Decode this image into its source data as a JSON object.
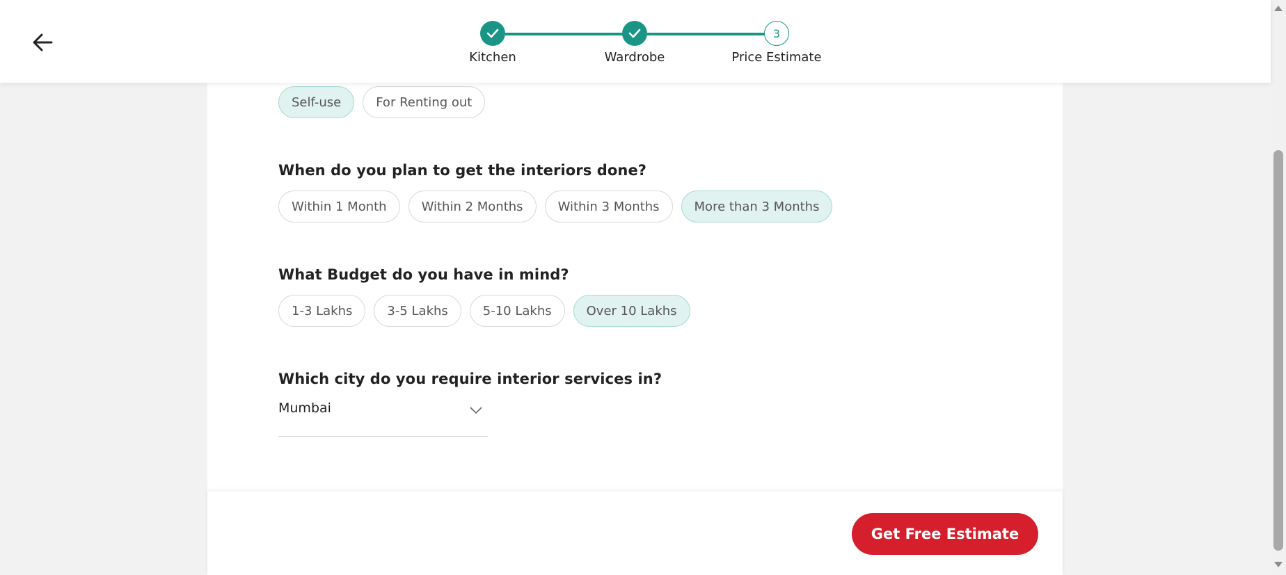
{
  "stepper": {
    "steps": [
      {
        "label": "Kitchen",
        "status": "completed"
      },
      {
        "label": "Wardrobe",
        "status": "completed"
      },
      {
        "label": "Price Estimate",
        "status": "current",
        "number": "3"
      }
    ],
    "accent_color": "#1a9585"
  },
  "form": {
    "usage_options": [
      "Self-use",
      "For Renting out"
    ],
    "usage_selected": "Self-use",
    "timeline_question": "When do you plan to get the interiors done?",
    "timeline_options": [
      "Within 1 Month",
      "Within 2 Months",
      "Within 3 Months",
      "More than 3 Months"
    ],
    "timeline_selected": "More than 3 Months",
    "budget_question": "What Budget do you have in mind?",
    "budget_options": [
      "1-3 Lakhs",
      "3-5 Lakhs",
      "5-10 Lakhs",
      "Over 10 Lakhs"
    ],
    "budget_selected": "Over 10 Lakhs",
    "city_question": "Which city do you require interior services in?",
    "city_value": "Mumbai"
  },
  "footer": {
    "cta_label": "Get Free Estimate",
    "cta_color": "#d51f2d"
  },
  "icons": {
    "back": "arrow-left-icon",
    "check": "check-icon",
    "chevron": "chevron-down-icon"
  }
}
